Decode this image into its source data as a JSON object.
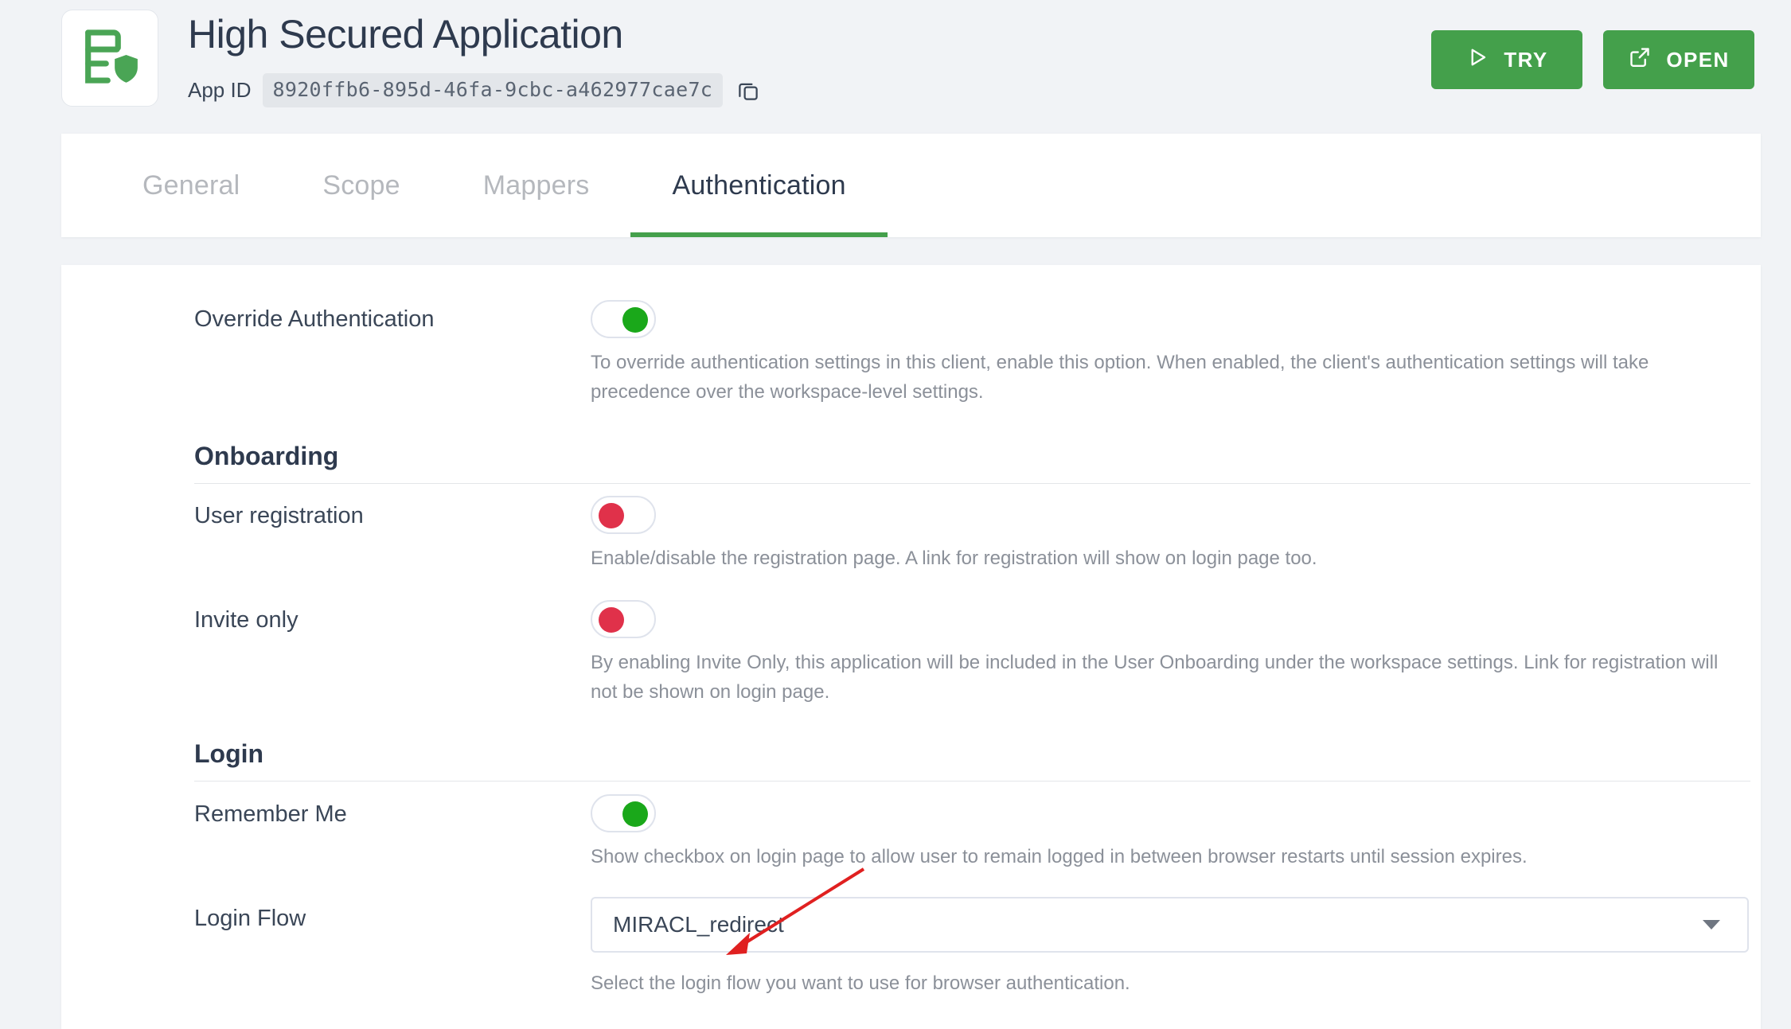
{
  "header": {
    "app_title": "High Secured Application",
    "app_id_label": "App ID",
    "app_id_value": "8920ffb6-895d-46fa-9cbc-a462977cae7c",
    "copy_icon": "copy-icon",
    "logo_icon": "secured-application-icon",
    "buttons": [
      {
        "label": "TRY",
        "icon": "play-icon"
      },
      {
        "label": "OPEN",
        "icon": "external-link-icon"
      }
    ],
    "accent_color": "#44a04b"
  },
  "tabs": [
    {
      "label": "General",
      "active": false
    },
    {
      "label": "Scope",
      "active": false
    },
    {
      "label": "Mappers",
      "active": false
    },
    {
      "label": "Authentication",
      "active": true
    }
  ],
  "form": {
    "override_authentication": {
      "label": "Override Authentication",
      "toggle_state": "on",
      "hint": "To override authentication settings in this client, enable this option. When enabled, the client's authentication settings will take precedence over the workspace-level settings."
    },
    "onboarding_section": {
      "title": "Onboarding"
    },
    "user_registration": {
      "label": "User registration",
      "toggle_state": "off",
      "hint": "Enable/disable the registration page. A link for registration will show on login page too."
    },
    "invite_only": {
      "label": "Invite only",
      "toggle_state": "off",
      "hint": "By enabling Invite Only, this application will be included in the User Onboarding under the workspace settings. Link for registration will not be shown on login page."
    },
    "login_section": {
      "title": "Login"
    },
    "remember_me": {
      "label": "Remember Me",
      "toggle_state": "on",
      "hint": "Show checkbox on login page to allow user to remain logged in between browser restarts until session expires."
    },
    "login_flow": {
      "label": "Login Flow",
      "selected_value": "MIRACL_redirect",
      "hint": "Select the login flow you want to use for browser authentication."
    }
  },
  "annotation": {
    "type": "arrow",
    "color": "#e02020",
    "points_to": "login-flow-select"
  },
  "colors": {
    "toggle_on": "#1aa81a",
    "toggle_off": "#e0314a",
    "page_background": "#f1f3f6",
    "text_primary": "#2e3a4e",
    "text_hint": "#8b9099"
  }
}
